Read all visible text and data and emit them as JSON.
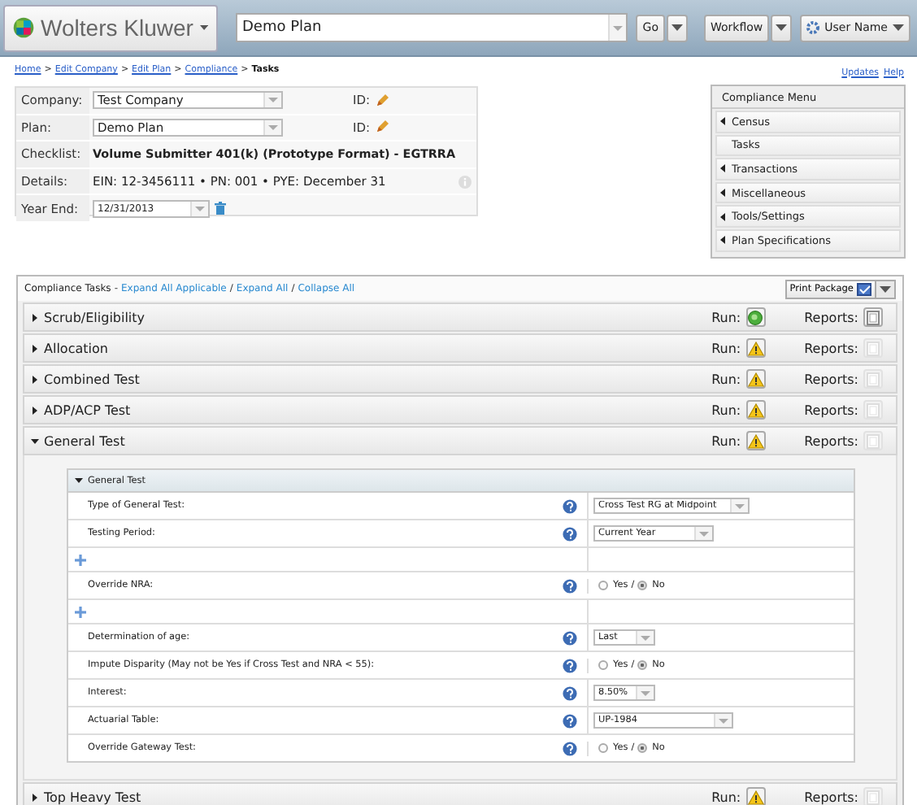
{
  "header": {
    "logo": "Wolters Kluwer",
    "plan_search": {
      "value": "Demo Plan"
    },
    "go_button": "Go",
    "workflow_button": "Workflow",
    "user_button": "User Name"
  },
  "breadcrumb": {
    "separator": ">",
    "items": [
      "Home",
      "Edit Company",
      "Edit Plan",
      "Compliance",
      "Tasks"
    ]
  },
  "top_links": [
    "Updates",
    "Help"
  ],
  "plan_info": [
    {
      "kind": "select",
      "label": "Company:",
      "value": "Test Company",
      "id_label": "ID:"
    },
    {
      "kind": "select",
      "label": "Plan:",
      "value": "Demo Plan",
      "id_label": "ID:"
    },
    {
      "kind": "bold",
      "label": "Checklist:",
      "value": "Volume Submitter 401(k) (Prototype Format) - EGTRRA"
    },
    {
      "kind": "details",
      "label": "Details:",
      "value": "EIN: 12-3456111 • PN: 001 • PYE: December 31"
    },
    {
      "kind": "date",
      "label": "Year End:",
      "value": "12/31/2013"
    }
  ],
  "compliance_menu": {
    "title": "Compliance Menu",
    "items": [
      {
        "label": "Census",
        "expandable": true
      },
      {
        "label": "Tasks",
        "expandable": false
      },
      {
        "label": "Transactions",
        "expandable": true
      },
      {
        "label": "Miscellaneous",
        "expandable": true
      },
      {
        "label": "Tools/Settings",
        "expandable": true
      },
      {
        "label": "Plan Specifications",
        "expandable": true
      }
    ]
  },
  "tasks": {
    "title": "Compliance Tasks",
    "title_separator": "-",
    "link_separator": "/",
    "links": [
      "Expand All Applicable",
      "Expand All",
      "Collapse All"
    ],
    "print_button": "Print Package",
    "sections": [
      {
        "name": "Scrub/Eligibility",
        "expanded": false,
        "run_label": "Run:",
        "run_passed": true,
        "reports_label": "Reports:",
        "reports_enabled": true
      },
      {
        "name": "Allocation",
        "expanded": false,
        "run_label": "Run:",
        "run_passed": false,
        "reports_label": "Reports:",
        "reports_enabled": false
      },
      {
        "name": "Combined Test",
        "expanded": false,
        "run_label": "Run:",
        "run_passed": false,
        "reports_label": "Reports:",
        "reports_enabled": false
      },
      {
        "name": "ADP/ACP Test",
        "expanded": false,
        "run_label": "Run:",
        "run_passed": false,
        "reports_label": "Reports:",
        "reports_enabled": false
      },
      {
        "name": "General Test",
        "expanded": true,
        "run_label": "Run:",
        "run_passed": false,
        "reports_label": "Reports:",
        "reports_enabled": false,
        "detail": {
          "title": "General Test",
          "rows": [
            {
              "kind": "select",
              "label": "Type of General Test:",
              "value": "Cross Test RG at Midpoint"
            },
            {
              "kind": "select",
              "label": "Testing Period:",
              "value": "Current Year"
            },
            {
              "kind": "add"
            },
            {
              "kind": "radio",
              "label": "Override NRA:",
              "separator": "/",
              "options": [
                {
                  "label": "Yes",
                  "selected": false
                },
                {
                  "label": "No",
                  "selected": true
                }
              ]
            },
            {
              "kind": "add"
            },
            {
              "kind": "select",
              "label": "Determination of age:",
              "value": "Last"
            },
            {
              "kind": "radio",
              "label": "Impute Disparity (May not be Yes if Cross Test and NRA < 55):",
              "separator": "/",
              "options": [
                {
                  "label": "Yes",
                  "selected": false
                },
                {
                  "label": "No",
                  "selected": true
                }
              ]
            },
            {
              "kind": "select",
              "label": "Interest:",
              "value": "8.50%"
            },
            {
              "kind": "select",
              "label": "Actuarial Table:",
              "value": "UP-1984"
            },
            {
              "kind": "radio",
              "label": "Override Gateway Test:",
              "separator": "/",
              "options": [
                {
                  "label": "Yes",
                  "selected": false
                },
                {
                  "label": "No",
                  "selected": true
                }
              ]
            }
          ]
        }
      },
      {
        "name": "Top Heavy Test",
        "expanded": false,
        "run_label": "Run:",
        "run_passed": false,
        "reports_label": "Reports:",
        "reports_enabled": false
      }
    ]
  }
}
